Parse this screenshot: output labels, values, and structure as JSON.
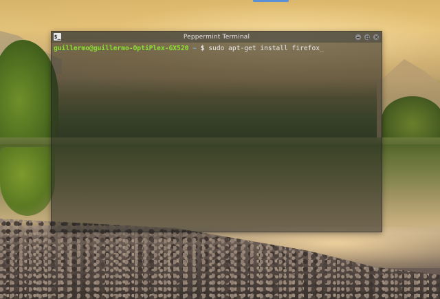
{
  "terminal": {
    "title": "Peppermint Terminal",
    "icon_label": "$_",
    "prompt_user_host": "guillermo@guillermo-OptiPlex-GX520",
    "prompt_path": " ~ ",
    "prompt_symbol": "$ ",
    "command": "sudo apt-get install firefox",
    "cursor": "_"
  },
  "icons": {
    "terminal_app": "terminal-icon",
    "minimize": "minimize-icon",
    "maximize": "maximize-icon",
    "close": "close-icon"
  },
  "colors": {
    "prompt_user": "#8ae234",
    "prompt_path": "#7aa6da",
    "text": "#e8e8e8"
  }
}
